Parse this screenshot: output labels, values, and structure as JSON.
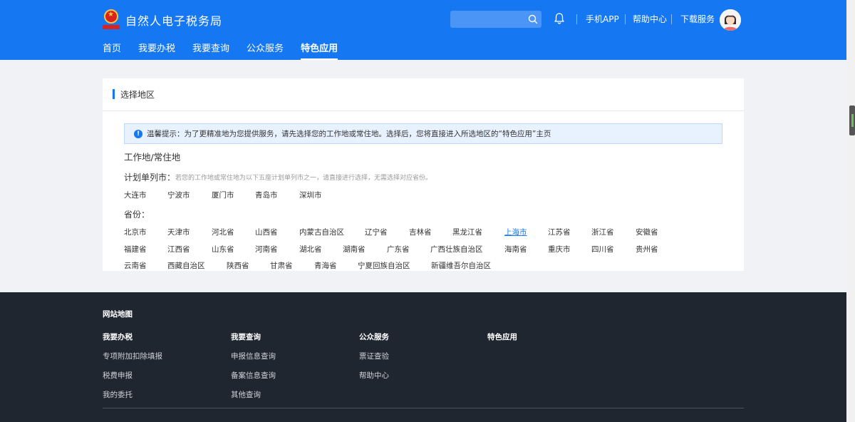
{
  "header": {
    "site_title": "自然人电子税务局",
    "search_placeholder": "",
    "links": [
      "手机APP",
      "帮助中心",
      "下载服务"
    ],
    "accent_color": "#1677f2"
  },
  "nav": {
    "items": [
      "首页",
      "我要办税",
      "我要查询",
      "公众服务",
      "特色应用"
    ],
    "active": "特色应用"
  },
  "card": {
    "title": "选择地区",
    "notice": "温馨提示：为了更精准地为您提供服务，请先选择您的工作地或常住地。选择后，您将直接进入所选地区的“特色应用”主页",
    "section_title": "工作地/常住地",
    "plan_label": "计划单列市：",
    "plan_hint": "若您的工作地或常住地为以下五座计划单列市之一，请直接进行选择，无需选择对应省份。",
    "plan_cities": [
      "大连市",
      "宁波市",
      "厦门市",
      "青岛市",
      "深圳市"
    ],
    "province_label": "省份：",
    "provinces": [
      [
        "北京市",
        "天津市",
        "河北省",
        "山西省",
        "内蒙古自治区",
        "辽宁省",
        "吉林省",
        "黑龙江省",
        "上海市",
        "江苏省",
        "浙江省",
        "安徽省"
      ],
      [
        "福建省",
        "江西省",
        "山东省",
        "河南省",
        "湖北省",
        "湖南省",
        "广东省",
        "广西壮族自治区",
        "海南省",
        "重庆市",
        "四川省",
        "贵州省"
      ],
      [
        "云南省",
        "西藏自治区",
        "陕西省",
        "甘肃省",
        "青海省",
        "宁夏回族自治区",
        "新疆维吾尔自治区"
      ]
    ],
    "selected_region": "上海市"
  },
  "footer": {
    "sitemap_title": "网站地图",
    "columns": [
      {
        "title": "我要办税",
        "links": [
          "专项附加扣除填报",
          "税费申报",
          "我的委托"
        ]
      },
      {
        "title": "我要查询",
        "links": [
          "申报信息查询",
          "备案信息查询",
          "其他查询"
        ]
      },
      {
        "title": "公众服务",
        "links": [
          "票证查验",
          "帮助中心"
        ]
      },
      {
        "title": "特色应用",
        "links": []
      }
    ]
  }
}
